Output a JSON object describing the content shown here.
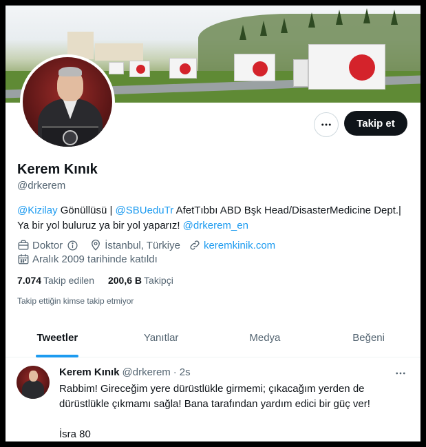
{
  "colors": {
    "accent": "#1d9bf0",
    "text": "#0f1419",
    "muted": "#536471",
    "follow_bg": "#0f1419"
  },
  "profile": {
    "name": "Kerem Kınık",
    "handle": "@drkerem",
    "bio": {
      "mention1": "@Kizilay",
      "text1": " Gönüllüsü | ",
      "mention2": "@SBUeduTr",
      "text2": " AfetTıbbı ABD Bşk Head/DisasterMedicine Dept.|",
      "text3": "Ya bir yol buluruz ya bir yol yaparız! ",
      "mention3": "@drkerem_en"
    },
    "profession": "Doktor",
    "location": "İstanbul, Türkiye",
    "website": "keremkinik.com",
    "joined": "Aralık 2009 tarihinde katıldı",
    "following_count": "7.074",
    "following_label": "Takip edilen",
    "followers_count": "200,6 B",
    "followers_label": "Takipçi",
    "mutual_note": "Takip ettiğin kimse takip etmiyor"
  },
  "buttons": {
    "follow": "Takip et",
    "more_icon": "more-horizontal-icon"
  },
  "tabs": [
    {
      "label": "Tweetler",
      "active": true
    },
    {
      "label": "Yanıtlar",
      "active": false
    },
    {
      "label": "Medya",
      "active": false
    },
    {
      "label": "Beğeni",
      "active": false
    }
  ],
  "tweet": {
    "name": "Kerem Kınık",
    "handle": "@drkerem",
    "separator": "·",
    "time": "2s",
    "lines": [
      "Rabbim! Gireceğim yere dürüstlükle girmemi; çıkacağım yerden de",
      "dürüstlükle çıkmamı sağla! Bana tarafından yardım edici bir güç ver!",
      "İsra 80"
    ]
  }
}
